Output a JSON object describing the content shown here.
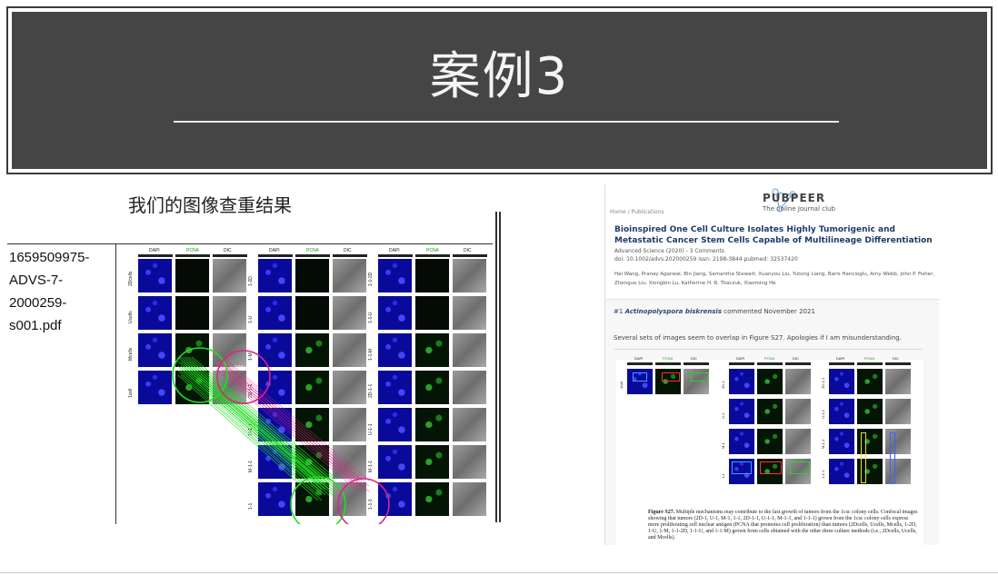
{
  "slide": {
    "title": "案例3",
    "left_caption": "我们的图像查重结果"
  },
  "file_table": {
    "filename_lines": [
      "1659509975-",
      "ADVS-7-",
      "2000259-",
      "s001.pdf"
    ]
  },
  "figure": {
    "column_headers": [
      "DAPI",
      "PCNA",
      "DIC"
    ],
    "group1_rows": [
      "2Dcells",
      "Ucells",
      "Mcells",
      "1cell"
    ],
    "group2_rows": [
      "1-2D",
      "1-U",
      "1-M",
      "2D-1-1",
      "U-1-1",
      "M-1-1",
      "1-1"
    ],
    "group3_rows": [
      "1-1-2D",
      "1-1-U",
      "1-1-M",
      "2D-1-1",
      "U-1-1",
      "M-1-1",
      "1-1-1"
    ],
    "scale_label": "100μm"
  },
  "pubpeer": {
    "brand": "PUBPEER",
    "tagline": "The online Journal club",
    "breadcrumb": "Home / Publications",
    "title": "Bioinspired One Cell Culture Isolates Highly Tumorigenic and Metastatic Cancer Stem Cells Capable of Multilineage Differentiation",
    "meta_line1": "Advanced Science (2020) - 3 Comments",
    "meta_line2": "doi: 10.1002/advs.202000259  issn: 2198-3844  pubmed: 32537420",
    "authors_line1": "Hai Wang, Pranay Agarwal, Bin Jiang, Samantha Stewart, Xuanyou Liu, Yutong Liang, Baris Hancioglu, Amy Webb, John P. Fisher,",
    "authors_line2": "Zhenguo Liu, Xiongbin Lu, Katherine H. R. Tkaczuk, Xiaoming He",
    "comment_number": "#1",
    "comment_author": "Actinopolyspora biskrensis",
    "comment_date": "commented November 2021",
    "comment_text": "Several sets of images seem to overlap in Figure S27. Apologies if I am misunderstanding.",
    "caption_label": "Figure S27.",
    "caption_text": "Multiple mechanisms may contribute to the fast growth of tumors from the 1csc colony cells. Confocal images showing that tumors (2D-1, U-1, M-1, 1-1, 2D-1-1, U-1-1, M-1-1, and 1-1-1) grown from the 1csc colony cells express more proliferating cell nuclear antigen (PCNA that promotes cell proliferation) than tumors (2Dcells, Ucells, Mcells, 1-2D, 1-U, 1-M, 1-1-2D, 1-1-U, and 1-1-M) grown from cells obtained with the other three culture methods (i.e., 2Dcells, Ucells, and Mcells).",
    "figure_headers": [
      "DAPI",
      "PCNA",
      "DIC"
    ],
    "fig_group1_rows": [
      "1cell"
    ],
    "fig_group2_rows": [
      "2D-1",
      "U-1",
      "M-1",
      "1-1"
    ],
    "fig_group3_rows": [
      "2D-1-1",
      "U-1-1",
      "M-1-1",
      "1-1-1"
    ],
    "fig_scale_label": "100μm"
  },
  "colors": {
    "banner": "#454545",
    "match_green": "#22dd22",
    "match_magenta": "#dd2288",
    "pubpeer_title": "#1f3a6b"
  }
}
